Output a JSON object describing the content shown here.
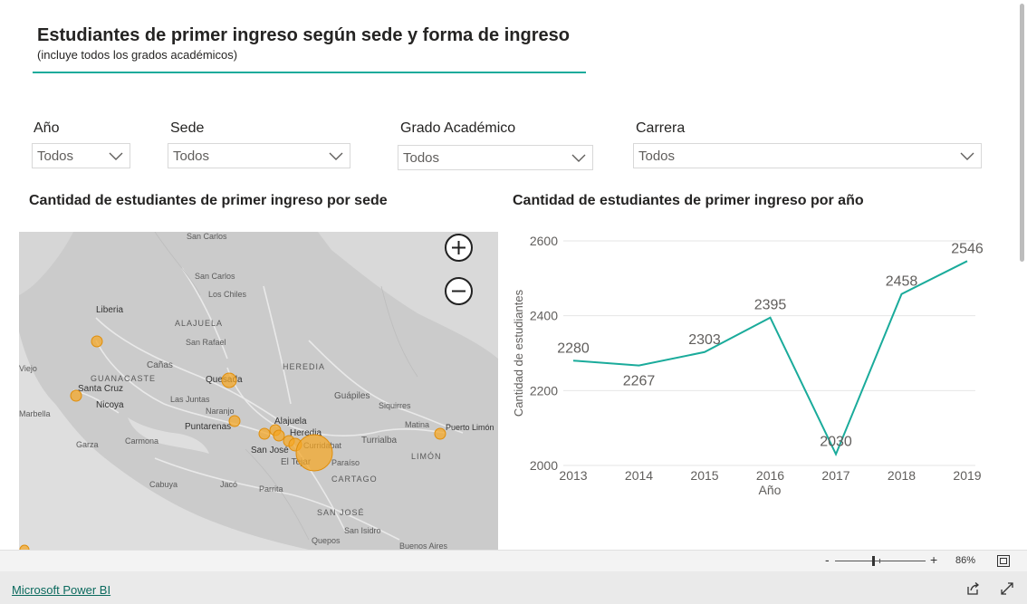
{
  "header": {
    "title": "Estudiantes de primer ingreso según sede y forma de ingreso",
    "subtitle": "(incluye todos los grados académicos)"
  },
  "slicers": [
    {
      "label": "Año",
      "value": "Todos"
    },
    {
      "label": "Sede",
      "value": "Todos"
    },
    {
      "label": "Grado Académico",
      "value": "Todos"
    },
    {
      "label": "Carrera",
      "value": "Todos"
    }
  ],
  "map_visual": {
    "title": "Cantidad de estudiantes de primer ingreso por sede",
    "place_labels": [
      "San Carlos",
      "Los Chiles",
      "ALAJUELA",
      "San Rafael",
      "Cañas",
      "HEREDIA",
      "GUANACASTE",
      "Las Juntas",
      "Naranjo",
      "Guápiles",
      "Siquirres",
      "Matina",
      "LIMÓN",
      "Carmona",
      "CARTAGO",
      "Cabuya",
      "Jacó",
      "Parrita",
      "SAN JOSÉ",
      "Quepos",
      "San Isidro",
      "Buenos Aires",
      "Viejo",
      "Marbella",
      "Garza",
      "Turrialba",
      "El Tejar",
      "Paraíso",
      "Curridabat"
    ],
    "city_labels": [
      "Liberia",
      "Santa Cruz",
      "Nicoya",
      "Quesada",
      "Puntarenas",
      "Alajuela",
      "Heredia",
      "San José",
      "Puerto Limón"
    ],
    "bubble_color": "#f5a623",
    "zoom_in_icon": "plus-icon",
    "zoom_out_icon": "minus-icon"
  },
  "line_visual": {
    "title": "Cantidad de estudiantes de primer ingreso por año",
    "line_color": "#1aab9b"
  },
  "chart_data": {
    "type": "line",
    "title": "Cantidad de estudiantes de primer ingreso por año",
    "xlabel": "Año",
    "ylabel": "Cantidad de estudiantes",
    "x": [
      "2013",
      "2014",
      "2015",
      "2016",
      "2017",
      "2018",
      "2019"
    ],
    "values": [
      2280,
      2267,
      2303,
      2395,
      2030,
      2458,
      2546
    ],
    "ylim": [
      2000,
      2600
    ],
    "yticks": [
      2000,
      2200,
      2400,
      2600
    ],
    "grid": true,
    "data_labels": true
  },
  "zoom_bar": {
    "minus": "-",
    "plus": "+",
    "zoom_level": "86%"
  },
  "footer": {
    "brand_link": "Microsoft Power BI"
  }
}
